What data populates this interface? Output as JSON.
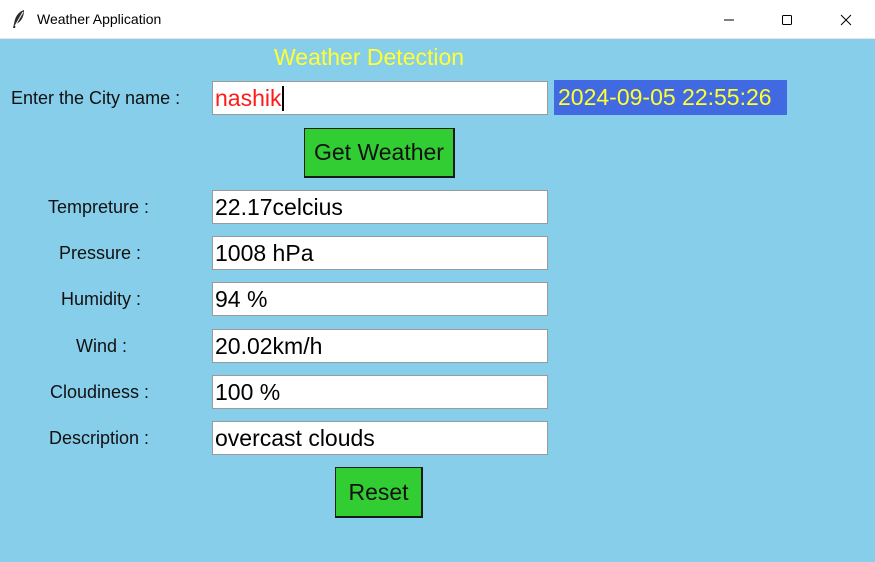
{
  "window": {
    "title": "Weather Application",
    "icon": "feather-icon",
    "controls": [
      "minimize-icon",
      "maximize-icon",
      "close-icon"
    ]
  },
  "heading": "Weather Detection",
  "city": {
    "label": "Enter the City name :",
    "value": "nashik"
  },
  "datetime": "2024-09-05 22:55:26",
  "get_weather_button": "Get Weather",
  "fields": {
    "temperature": {
      "label": "Tempreture :",
      "value": "22.17celcius"
    },
    "pressure": {
      "label": "Pressure :",
      "value": "1008 hPa"
    },
    "humidity": {
      "label": "Humidity :",
      "value": "94 %"
    },
    "wind": {
      "label": "Wind :",
      "value": "20.02km/h"
    },
    "cloudiness": {
      "label": "Cloudiness :",
      "value": "100 %"
    },
    "description": {
      "label": "Description :",
      "value": "overcast clouds"
    }
  },
  "reset_button": "Reset",
  "colors": {
    "background": "#87ceeb",
    "heading": "#ffff33",
    "city_text": "#ff1a1a",
    "datetime_bg": "#4169e1",
    "datetime_text": "#ffff33",
    "button_bg": "#32cd32"
  }
}
